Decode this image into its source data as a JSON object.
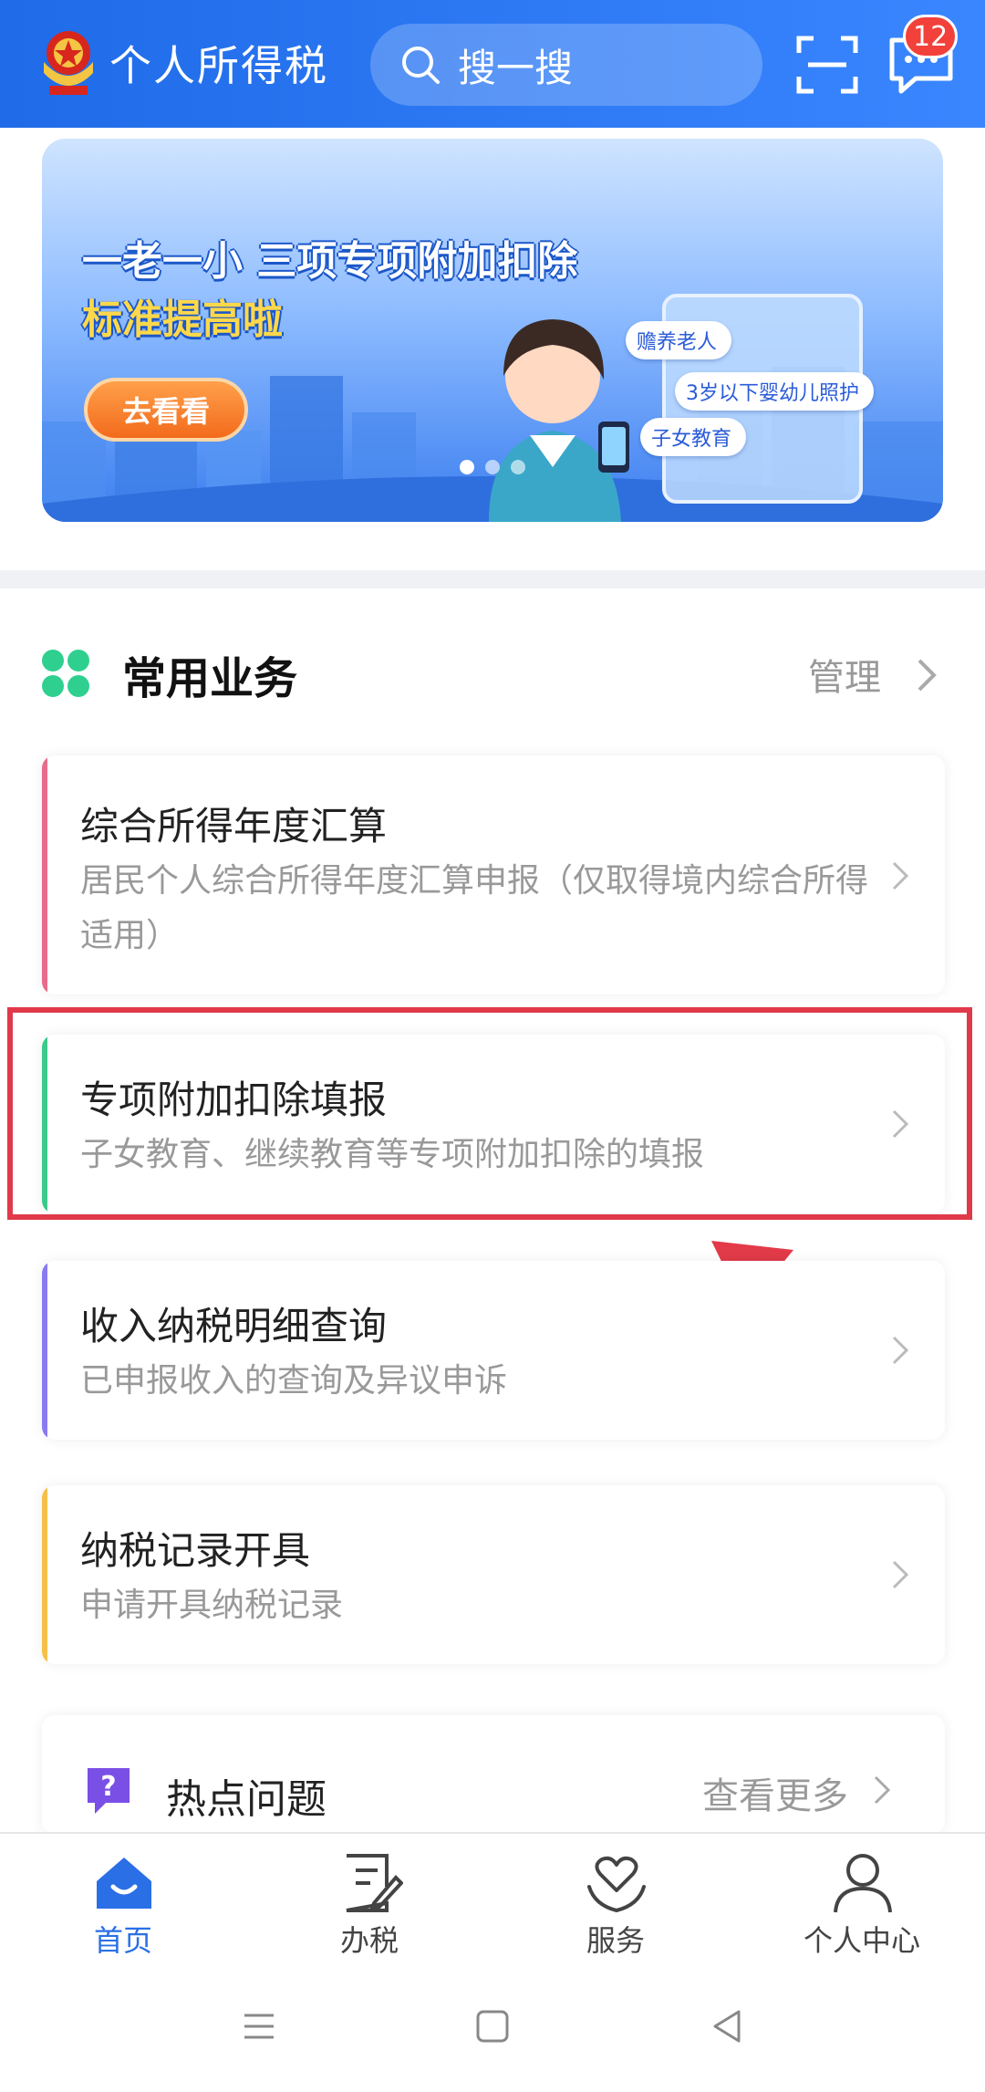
{
  "header": {
    "app_title": "个人所得税",
    "search_placeholder": "搜一搜",
    "message_badge": "12",
    "colors": {
      "primary": "#1f6be8",
      "badge": "#f2403a"
    }
  },
  "banner": {
    "line1": "一老一小 三项专项附加扣除",
    "line2": "标准提高啦",
    "button_label": "去看看",
    "tags": [
      "赡养老人",
      "3岁以下婴幼儿照护",
      "子女教育"
    ],
    "dots_total": 3,
    "active_dot": 1
  },
  "common_services": {
    "title": "常用业务",
    "manage_label": "管理",
    "items": [
      {
        "title": "综合所得年度汇算",
        "subtitle": "居民个人综合所得年度汇算申报（仅取得境内综合所得适用）",
        "accent": "#e86b8a"
      },
      {
        "title": "专项附加扣除填报",
        "subtitle": "子女教育、继续教育等专项附加扣除的填报",
        "accent": "#3cc98b",
        "highlighted": true
      },
      {
        "title": "收入纳税明细查询",
        "subtitle": "已申报收入的查询及异议申诉",
        "accent": "#8a7af2"
      },
      {
        "title": "纳税记录开具",
        "subtitle": "申请开具纳税记录",
        "accent": "#f5c04a"
      }
    ]
  },
  "hot_topics": {
    "title": "热点问题",
    "more_label": "查看更多"
  },
  "tabbar": {
    "tabs": [
      {
        "label": "首页",
        "icon": "home-icon",
        "active": true
      },
      {
        "label": "办税",
        "icon": "tax-form-icon",
        "active": false
      },
      {
        "label": "服务",
        "icon": "heart-hands-icon",
        "active": false
      },
      {
        "label": "个人中心",
        "icon": "user-icon",
        "active": false
      }
    ],
    "active_color": "#2a6fe6"
  },
  "system_nav": {
    "buttons": [
      "menu-icon",
      "home-square-icon",
      "back-triangle-icon"
    ]
  }
}
